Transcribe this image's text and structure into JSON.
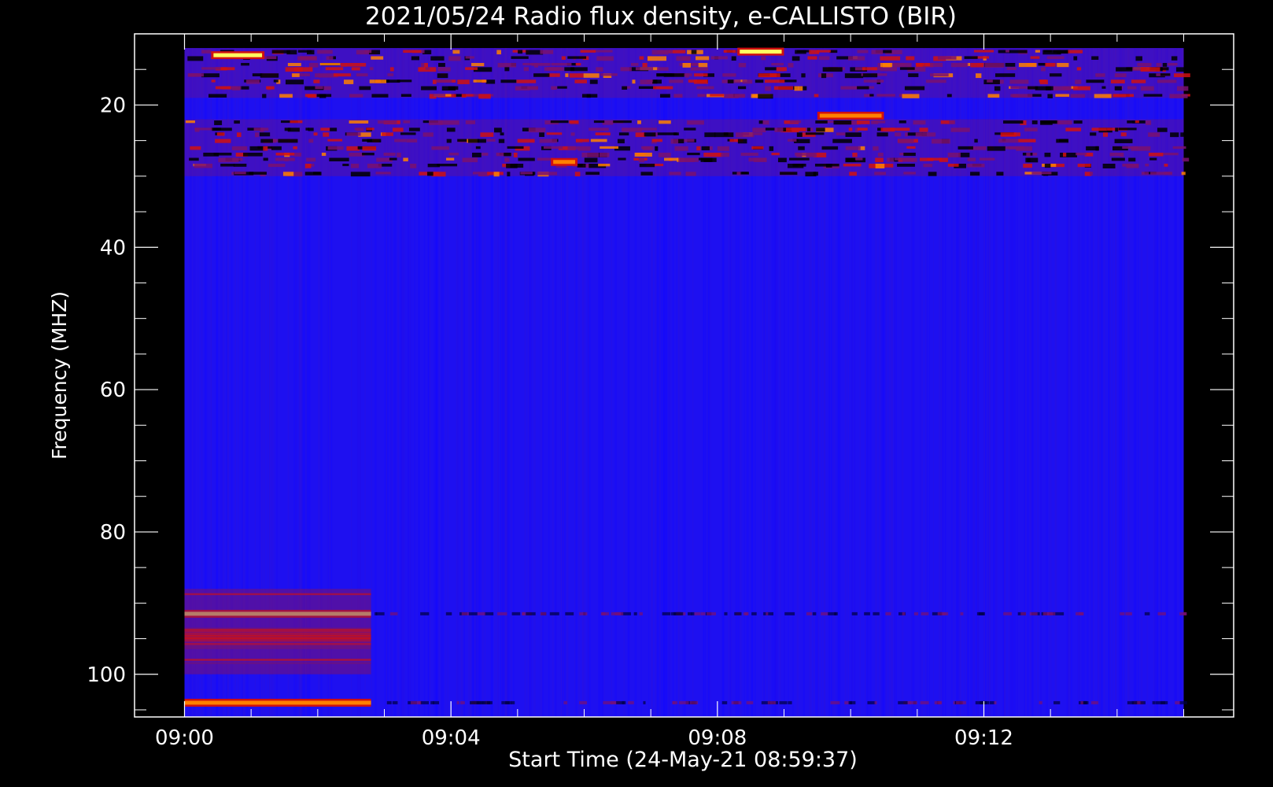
{
  "chart_data": {
    "type": "heatmap",
    "title": "2021/05/24  Radio flux density, e-CALLISTO (BIR)",
    "xlabel": "Start Time (24-May-21 08:59:37)",
    "ylabel": "Frequency (MHZ)",
    "x_ticks": [
      "09:00",
      "09:04",
      "09:08",
      "09:12"
    ],
    "x_tick_minutes": [
      0,
      4,
      8,
      12
    ],
    "x_range_minutes": [
      -0.75,
      15.75
    ],
    "data_x_range_minutes": [
      0,
      15
    ],
    "y_ticks": [
      20,
      40,
      60,
      80,
      100
    ],
    "y_range_mhz": [
      10,
      106
    ],
    "data_y_range_mhz": [
      12,
      106
    ],
    "colormap": [
      "#000000",
      "#1a00ff",
      "#7a1070",
      "#d01010",
      "#ff8000",
      "#ffff60"
    ],
    "background_color": "#1e10f0",
    "features": [
      {
        "kind": "band",
        "freq_mhz": 91.5,
        "t_start": 0,
        "t_end": 2.8,
        "level": 5
      },
      {
        "kind": "band",
        "freq_mhz": 104,
        "t_start": 0,
        "t_end": 2.8,
        "level": 4
      },
      {
        "kind": "block",
        "freq_from": 88,
        "freq_to": 100,
        "t_start": 0,
        "t_end": 2.8,
        "level": 2
      },
      {
        "kind": "rfi",
        "freq_from": 12,
        "freq_to": 19,
        "t_start": 0,
        "t_end": 15,
        "level": 3
      },
      {
        "kind": "rfi",
        "freq_from": 22,
        "freq_to": 30,
        "t_start": 0,
        "t_end": 15,
        "level": 3
      },
      {
        "kind": "hotspot",
        "freq_mhz": 13,
        "t_start": 0.4,
        "t_end": 1.2,
        "level": 5
      },
      {
        "kind": "hotspot",
        "freq_mhz": 12.5,
        "t_start": 8.3,
        "t_end": 9.0,
        "level": 5
      },
      {
        "kind": "hotspot",
        "freq_mhz": 21.5,
        "t_start": 9.5,
        "t_end": 10.5,
        "level": 4
      },
      {
        "kind": "hotspot",
        "freq_mhz": 28,
        "t_start": 5.5,
        "t_end": 5.9,
        "level": 4
      }
    ]
  }
}
